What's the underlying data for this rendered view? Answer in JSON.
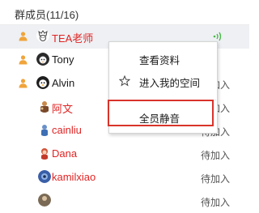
{
  "header": {
    "title": "群成员(11/16)"
  },
  "members": [
    {
      "name": "TEA老师",
      "status": "",
      "name_color": "#e02424",
      "role": "owner"
    },
    {
      "name": "Tony",
      "status": "",
      "name_color": "#1a1a1a",
      "role": "admin"
    },
    {
      "name": "Alvin",
      "status": "待加入",
      "name_color": "#1a1a1a",
      "role": "admin"
    },
    {
      "name": "阿文",
      "status": "待加入",
      "name_color": "#e02424",
      "role": "member"
    },
    {
      "name": "cainliu",
      "status": "待加入",
      "name_color": "#e02424",
      "role": "member"
    },
    {
      "name": "Dana",
      "status": "待加入",
      "name_color": "#e02424",
      "role": "member"
    },
    {
      "name": "kamilxiao",
      "status": "待加入",
      "name_color": "#e02424",
      "role": "member"
    },
    {
      "name": "",
      "status": "待加入",
      "name_color": "#e02424",
      "role": "member"
    }
  ],
  "context_menu": {
    "view_profile": "查看资料",
    "enter_space": "进入我的空间",
    "mute_all": "全员静音"
  },
  "colors": {
    "name_red": "#e02424",
    "highlight": "#d9342b",
    "selected_row": "#eef0f3",
    "voice_green": "#4cb84c"
  },
  "icons": {
    "owner": "user-crown-icon",
    "admin": "user-admin-icon",
    "voice": "voice-wave-icon",
    "star": "star-icon"
  }
}
